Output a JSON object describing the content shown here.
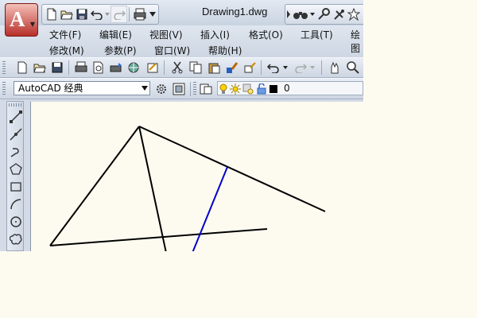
{
  "window": {
    "title": "Drawing1.dwg",
    "app_logo": "A"
  },
  "quick_access": {
    "icons": [
      "new-icon",
      "open-icon",
      "save-icon",
      "undo-icon",
      "redo-icon",
      "plot-icon"
    ]
  },
  "menu": {
    "row1": [
      "文件(F)",
      "编辑(E)",
      "视图(V)",
      "插入(I)",
      "格式(O)",
      "工具(T)",
      "绘图"
    ],
    "row2": [
      "修改(M)",
      "参数(P)",
      "窗口(W)",
      "帮助(H)"
    ]
  },
  "workspace": {
    "selected": "AutoCAD 经典"
  },
  "layer": {
    "current": "0"
  },
  "colors": {
    "canvas_bg": "#fdfbf0",
    "line_black": "#000000",
    "line_blue": "#0000cc",
    "app_red": "#b8302a"
  }
}
